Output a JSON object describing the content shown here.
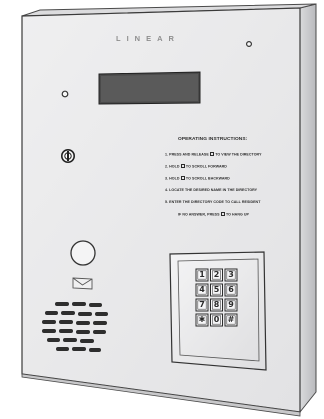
{
  "device": {
    "brand": "LINEAR",
    "body_color": "#e9e9ea",
    "edge_color": "#cfd0d2",
    "outline_color": "#3a3a3a"
  },
  "instructions": {
    "title": "OPERATING INSTRUCTIONS:",
    "steps": [
      {
        "pre": "1. PRESS AND RELEASE",
        "key": true,
        "post": "TO VIEW THE DIRECTORY"
      },
      {
        "pre": "2. HOLD",
        "key": true,
        "post": "TO SCROLL FORWARD"
      },
      {
        "pre": "3. HOLD",
        "key": true,
        "post": "TO SCROLL BACKWARD"
      },
      {
        "pre": "4. LOCATE THE DESIRED NAME IN THE DIRECTORY",
        "key": false,
        "post": ""
      },
      {
        "pre": "5. ENTER THE DIRECTORY CODE TO CALL RESIDENT",
        "key": false,
        "post": ""
      },
      {
        "pre": "IF NO ANSWER, PRESS",
        "key": true,
        "post": "TO HANG UP"
      }
    ]
  },
  "keypad": {
    "keys": [
      "1",
      "2",
      "3",
      "4",
      "5",
      "6",
      "7",
      "8",
      "9",
      "✱",
      "0",
      "#"
    ]
  },
  "icons": [
    "envelope-icon",
    "key-lock-icon",
    "speaker-grille-icon"
  ]
}
